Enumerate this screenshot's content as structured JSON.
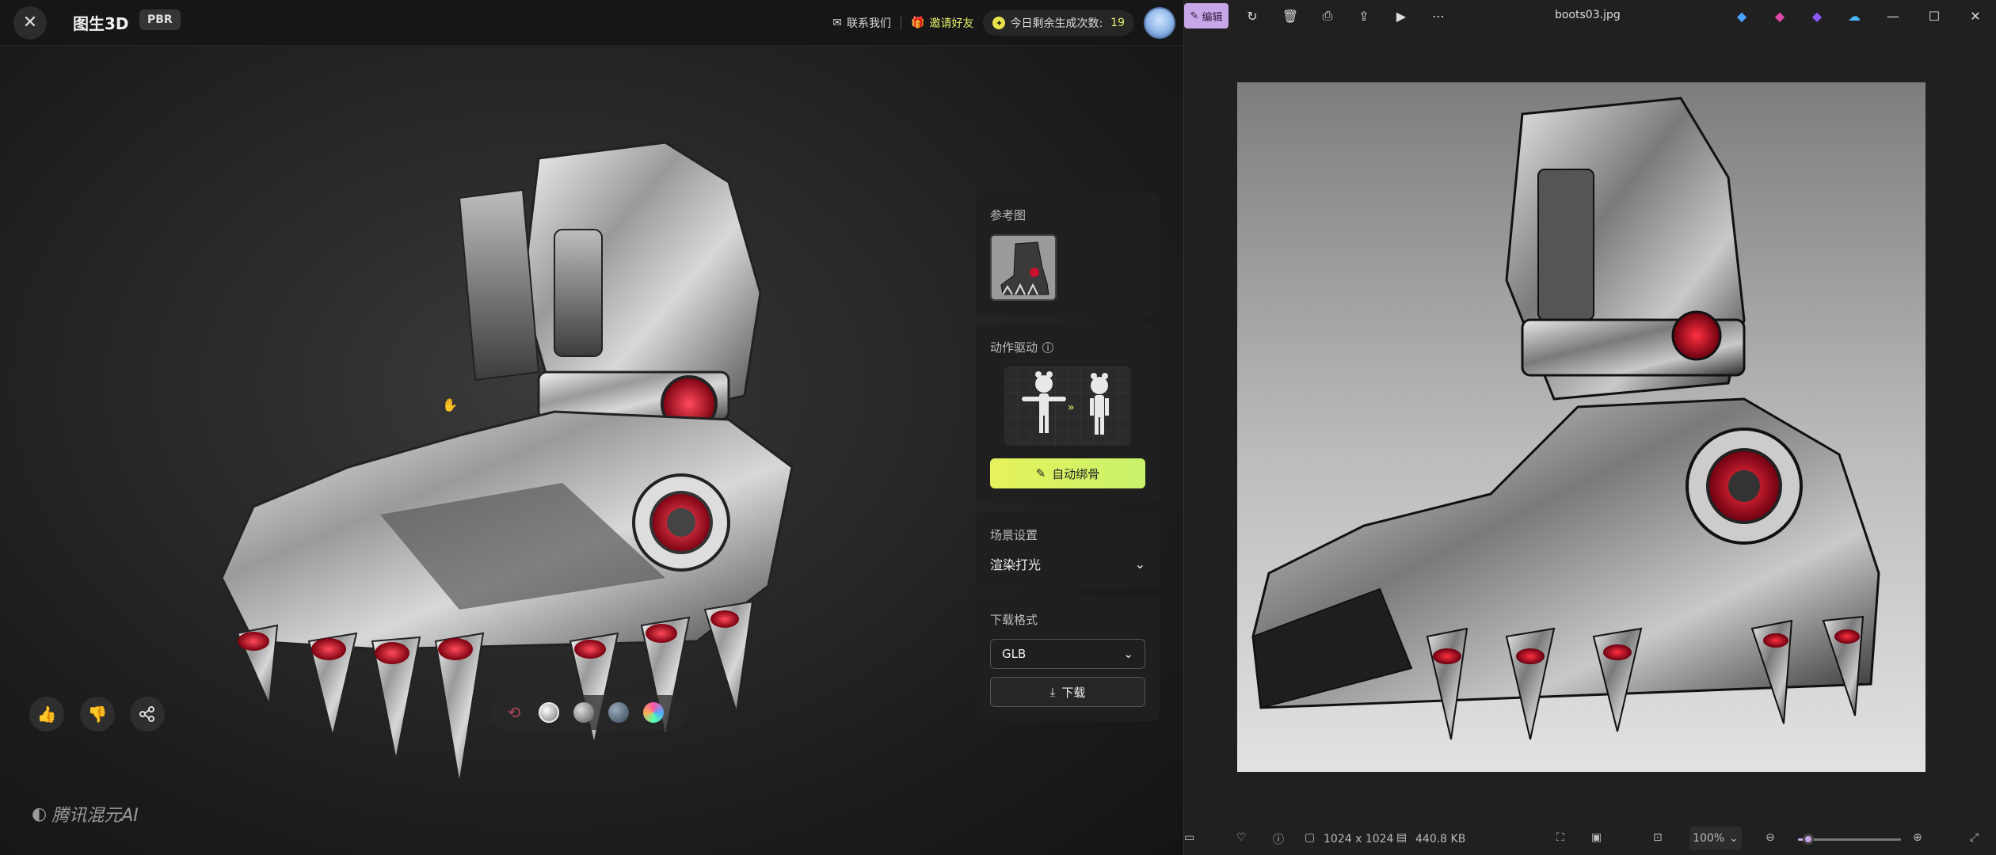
{
  "left_app": {
    "title": "图生3D",
    "badge": "PBR",
    "header": {
      "contact_label": "联系我们",
      "invite_label": "邀请好友",
      "quota_label": "今日剩余生成次数:",
      "quota_value": "19"
    },
    "panel": {
      "reference_title": "参考图",
      "motion_title": "动作驱动",
      "auto_rig_label": "自动绑骨",
      "scene_title": "场景设置",
      "scene_selected": "渲染打光",
      "download_title": "下载格式",
      "format_selected": "GLB",
      "download_label": "下载"
    },
    "material_progress": 0.2,
    "watermark": "腾讯混元AI"
  },
  "right_app": {
    "file_name": "boots03.jpg",
    "edit_label": "编辑",
    "dimensions": "1024 x 1024",
    "file_size": "440.8 KB",
    "zoom_level": "100%",
    "zoom_fraction": 0.1
  },
  "colors": {
    "accent_yellow": "#e6f06a",
    "photos_accent": "#c9a6e8",
    "boot_red": "#c8102e"
  }
}
